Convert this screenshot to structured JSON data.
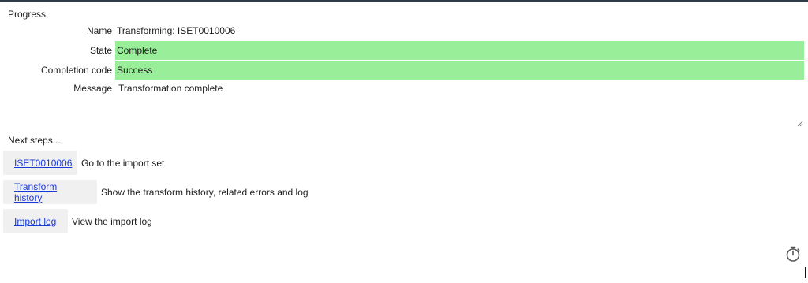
{
  "progress": {
    "title": "Progress",
    "fields": {
      "name": {
        "label": "Name",
        "value": "Transforming: ISET0010006"
      },
      "state": {
        "label": "State",
        "value": "Complete"
      },
      "completion_code": {
        "label": "Completion code",
        "value": "Success"
      },
      "message": {
        "label": "Message",
        "value": "Transformation complete"
      }
    },
    "highlight_color": "#99ee99"
  },
  "next_steps": {
    "title": "Next steps...",
    "items": [
      {
        "link": "ISET0010006",
        "description": "Go to the import set"
      },
      {
        "link": "Transform history",
        "description": "Show the transform history, related errors and log"
      },
      {
        "link": "Import log",
        "description": "View the import log"
      }
    ]
  },
  "icons": {
    "timer": "stopwatch-icon"
  }
}
